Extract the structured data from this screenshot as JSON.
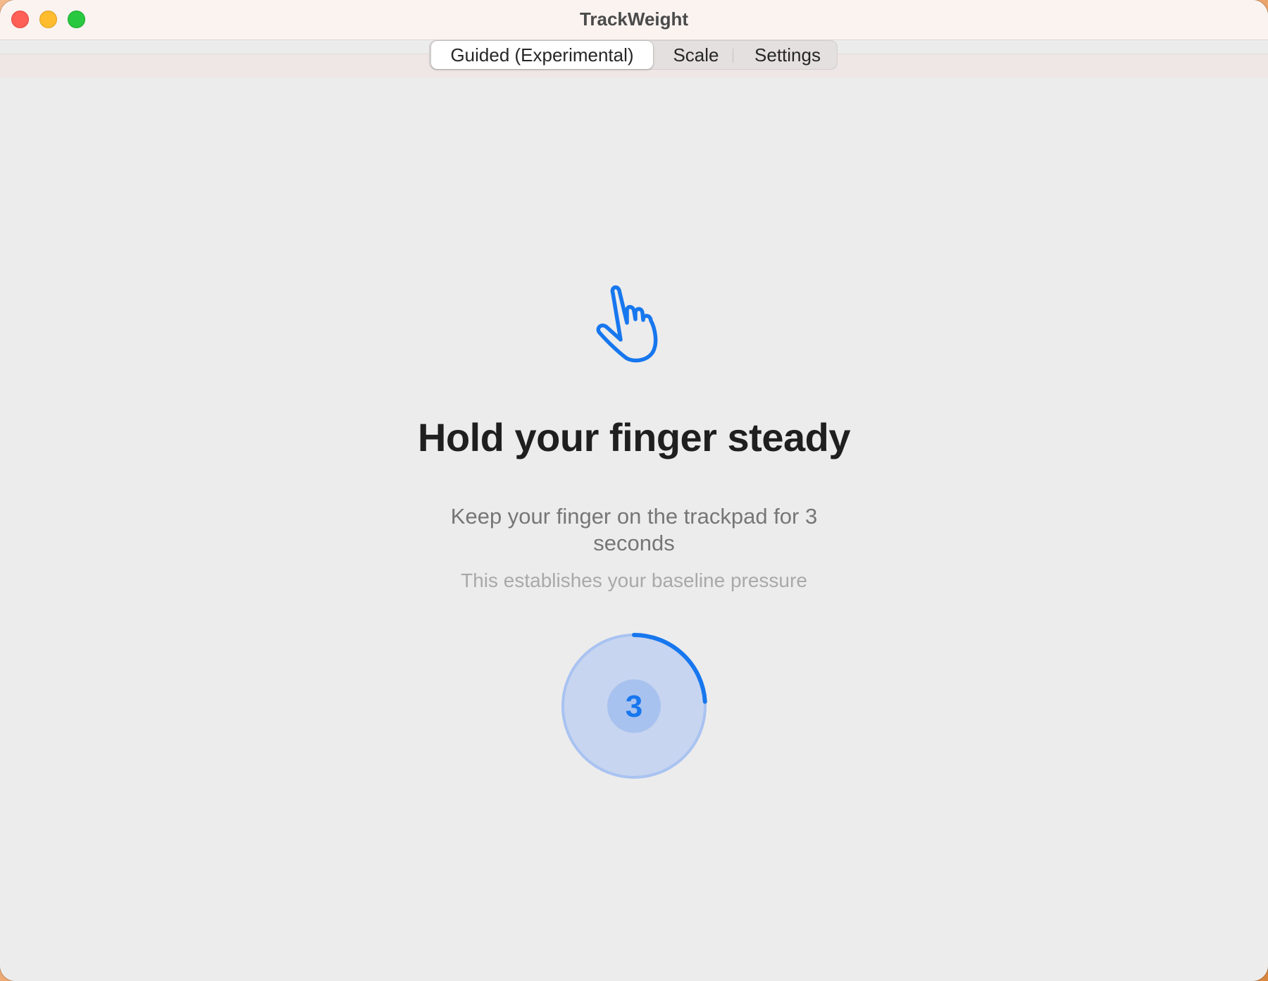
{
  "window": {
    "title": "TrackWeight"
  },
  "tabs": [
    {
      "label": "Guided (Experimental)",
      "selected": true
    },
    {
      "label": "Scale",
      "selected": false
    },
    {
      "label": "Settings",
      "selected": false
    }
  ],
  "main": {
    "icon": "hand-point-up-icon",
    "headline": "Hold your finger steady",
    "instruction": "Keep your finger on the trackpad for 3 seconds",
    "hint": "This establishes your baseline pressure",
    "countdown": {
      "value": "3",
      "progress": 0.24
    }
  },
  "colors": {
    "accent": "#1777ee",
    "ring_fill": "#c7d5f0",
    "close": "#fe5f57",
    "minimize": "#febc2e",
    "zoom": "#28c840"
  }
}
